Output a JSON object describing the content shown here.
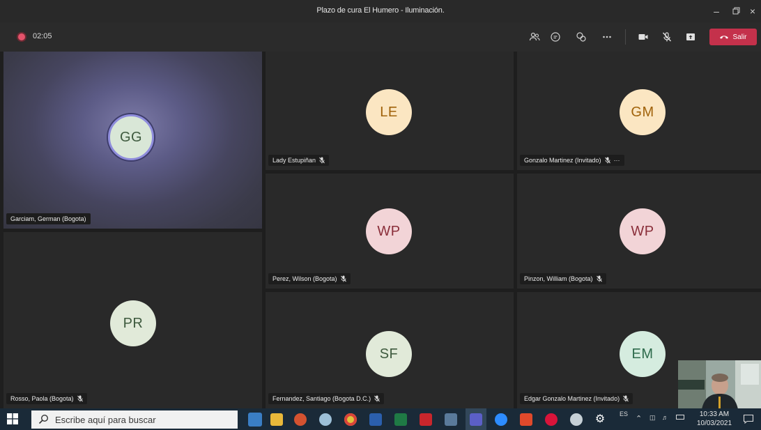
{
  "window": {
    "title": "Plazo de cura El Humero - Iluminación.",
    "minimize_icon": "minimize-icon",
    "maximize_icon": "maximize-icon",
    "close_icon": "close-icon"
  },
  "toolbar": {
    "recording_color": "#e3536b",
    "timer": "02:05",
    "leave_label": "Salir",
    "leave_color": "#c4314b",
    "icons": [
      "participants-icon",
      "chat-icon",
      "reactions-icon",
      "more-options-icon",
      "camera-icon",
      "mic-off-icon",
      "share-screen-icon",
      "phone-hangup-icon"
    ]
  },
  "participants": [
    {
      "initials": "GG",
      "name": "Garciam, German (Bogota)",
      "muted": false,
      "speaking": true,
      "avatar_bg": "#d9e7d7",
      "avatar_fg": "#3e5a3e"
    },
    {
      "initials": "LE",
      "name": "Lady Estupiñan",
      "muted": true,
      "avatar_bg": "#fbe6c2",
      "avatar_fg": "#a0620a"
    },
    {
      "initials": "GM",
      "name": "Gonzalo Martinez (Invitado)",
      "muted": true,
      "more": "···",
      "avatar_bg": "#fbe6c2",
      "avatar_fg": "#a0620a"
    },
    {
      "initials": "WP",
      "name": "Perez, Wilson (Bogota)",
      "muted": true,
      "avatar_bg": "#f2d4d7",
      "avatar_fg": "#8a2f3a"
    },
    {
      "initials": "WP",
      "name": "Pinzon, William (Bogota)",
      "muted": true,
      "avatar_bg": "#f2d4d7",
      "avatar_fg": "#8a2f3a"
    },
    {
      "initials": "PR",
      "name": "Rosso, Paola (Bogota)",
      "muted": true,
      "avatar_bg": "#e1ead9",
      "avatar_fg": "#3e5a3e"
    },
    {
      "initials": "SF",
      "name": "Fernandez, Santiago (Bogota D.C.)",
      "muted": true,
      "avatar_bg": "#e1ead9",
      "avatar_fg": "#3e5a3e"
    },
    {
      "initials": "EM",
      "name": "Edgar Gonzalo Martinez (Invitado)",
      "muted": true,
      "avatar_bg": "#d5ecdf",
      "avatar_fg": "#2e6b4c"
    }
  ],
  "taskbar": {
    "search_placeholder": "Escribe aquí para buscar",
    "language": "ES",
    "time": "10:33 AM",
    "date": "10/03/2021",
    "apps": [
      "outlook-icon",
      "file-explorer-icon",
      "powerpoint-icon",
      "paint-icon",
      "chrome-icon",
      "word-icon",
      "excel-icon",
      "acrobat-icon",
      "calculator-icon",
      "teams-icon",
      "zoom-icon",
      "office-icon",
      "opera-icon",
      "steam-icon",
      "settings-icon"
    ],
    "tray_icons": [
      "chevron-up-icon",
      "network-icon",
      "volume-icon",
      "battery-icon"
    ]
  }
}
